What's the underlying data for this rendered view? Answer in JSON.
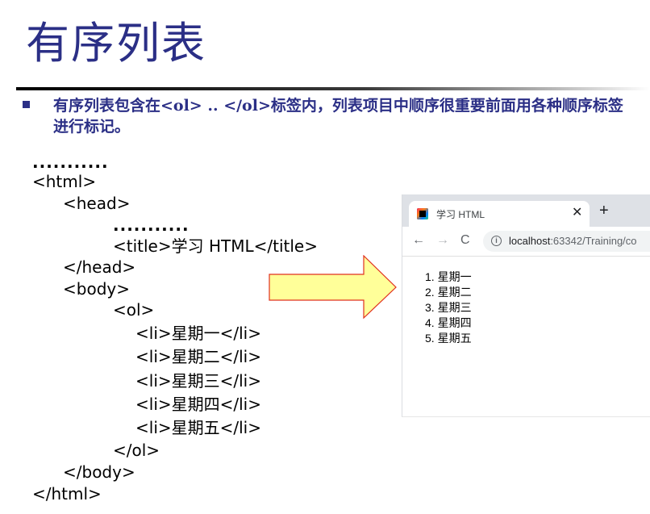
{
  "slide": {
    "title": "有序列表",
    "bullet": "有序列表包含在<ol> .. </ol>标签内，列表项目中顺序很重要前面用各种顺序标签进行标记。"
  },
  "code": {
    "dots": "...........",
    "html_open": "<html>",
    "head_open": "<head>",
    "title_line": "<title>学习 HTML</title>",
    "head_close": "</head>",
    "body_open": "<body>",
    "ol_open": "<ol>",
    "items": [
      "<li>星期一</li>",
      "<li>星期二</li>",
      "<li>星期三</li>",
      "<li>星期四</li>",
      "<li>星期五</li>"
    ],
    "ol_close": "</ol>",
    "body_close": "</body>",
    "html_close": "</html>"
  },
  "browser": {
    "tab_title": "学习 HTML",
    "close_glyph": "✕",
    "new_tab_glyph": "+",
    "back_glyph": "←",
    "forward_glyph": "→",
    "reload_glyph": "C",
    "url_host": "localhost",
    "url_rest": ":63342/Training/co",
    "list": [
      "1. 星期一",
      "2. 星期二",
      "3. 星期三",
      "4. 星期四",
      "5. 星期五"
    ]
  },
  "colors": {
    "title": "#2b2f86",
    "arrow_fill": "#ffff99",
    "arrow_stroke": "#e0301e"
  }
}
